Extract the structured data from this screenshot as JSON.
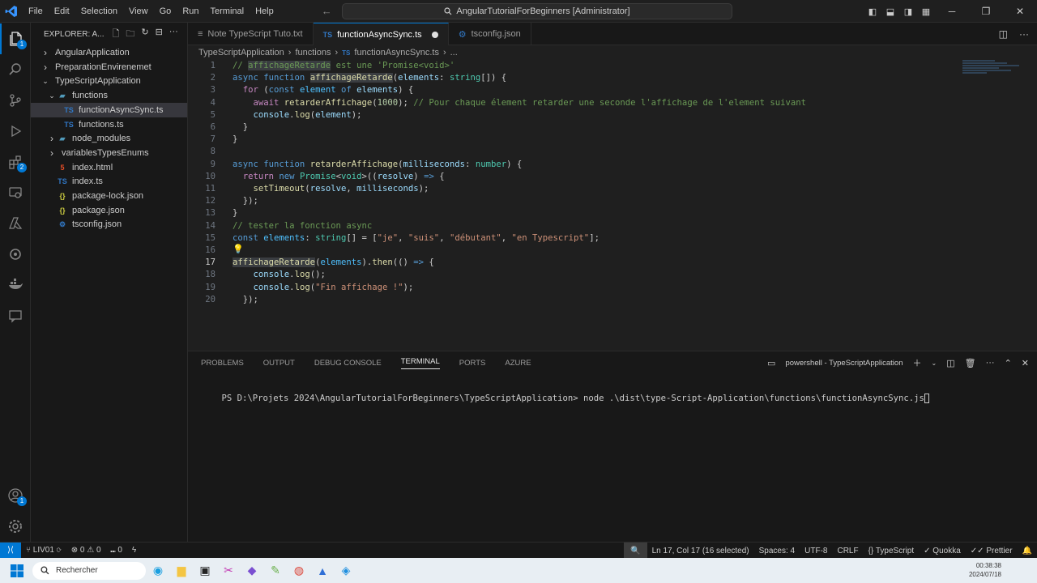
{
  "titlebar": {
    "menu": [
      "File",
      "Edit",
      "Selection",
      "View",
      "Go",
      "Run",
      "Terminal",
      "Help"
    ],
    "search": "AngularTutorialForBeginners [Administrator]"
  },
  "explorer": {
    "title": "EXPLORER: A...",
    "items": [
      {
        "label": "AngularApplication",
        "depth": 0,
        "chevron": "right",
        "icon": ""
      },
      {
        "label": "PreparationEnvirenemet",
        "depth": 0,
        "chevron": "right",
        "icon": ""
      },
      {
        "label": "TypeScriptApplication",
        "depth": 0,
        "chevron": "down",
        "icon": ""
      },
      {
        "label": "functions",
        "depth": 1,
        "chevron": "down",
        "icon": "folder"
      },
      {
        "label": "functionAsyncSync.ts",
        "depth": 2,
        "chevron": "",
        "icon": "ts",
        "selected": true
      },
      {
        "label": "functions.ts",
        "depth": 2,
        "chevron": "",
        "icon": "ts"
      },
      {
        "label": "node_modules",
        "depth": 1,
        "chevron": "right",
        "icon": "folder"
      },
      {
        "label": "variablesTypesEnums",
        "depth": 1,
        "chevron": "right",
        "icon": ""
      },
      {
        "label": "index.html",
        "depth": 1,
        "chevron": "",
        "icon": "html"
      },
      {
        "label": "index.ts",
        "depth": 1,
        "chevron": "",
        "icon": "ts"
      },
      {
        "label": "package-lock.json",
        "depth": 1,
        "chevron": "",
        "icon": "json"
      },
      {
        "label": "package.json",
        "depth": 1,
        "chevron": "",
        "icon": "json"
      },
      {
        "label": "tsconfig.json",
        "depth": 1,
        "chevron": "",
        "icon": "tsconfig"
      }
    ]
  },
  "tabs": [
    {
      "label": "Note TypeScript Tuto.txt",
      "active": false,
      "dirty": false
    },
    {
      "label": "functionAsyncSync.ts",
      "active": true,
      "dirty": true
    },
    {
      "label": "tsconfig.json",
      "active": false,
      "dirty": false
    }
  ],
  "breadcrumb": [
    "TypeScriptApplication",
    "functions",
    "functionAsyncSync.ts",
    "..."
  ],
  "editor": {
    "current_line": 17,
    "lines": [
      [
        [
          "com",
          "// "
        ],
        [
          "com hl",
          "affichageRetarde"
        ],
        [
          "com",
          " est une 'Promise<void>'"
        ]
      ],
      [
        [
          "kw",
          "async "
        ],
        [
          "kw",
          "function "
        ],
        [
          "fn hl",
          "affichageRetarde"
        ],
        [
          "",
          "("
        ],
        [
          "var",
          "elements"
        ],
        [
          "",
          ": "
        ],
        [
          "typ",
          "string"
        ],
        [
          "",
          "[]) {"
        ]
      ],
      [
        [
          "",
          "  "
        ],
        [
          "ctl",
          "for "
        ],
        [
          "",
          "("
        ],
        [
          "kw",
          "const "
        ],
        [
          "cst",
          "element "
        ],
        [
          "kw",
          "of "
        ],
        [
          "var",
          "elements"
        ],
        [
          "",
          ") {"
        ]
      ],
      [
        [
          "",
          "    "
        ],
        [
          "ctl",
          "await "
        ],
        [
          "fn",
          "retarderAffichage"
        ],
        [
          "",
          "("
        ],
        [
          "num",
          "1000"
        ],
        [
          "",
          "); "
        ],
        [
          "com",
          "// Pour chaque élement retarder une seconde l'affichage de l'element suivant"
        ]
      ],
      [
        [
          "",
          "    "
        ],
        [
          "var",
          "console"
        ],
        [
          "",
          "."
        ],
        [
          "fn",
          "log"
        ],
        [
          "",
          "("
        ],
        [
          "var",
          "element"
        ],
        [
          "",
          ");"
        ]
      ],
      [
        [
          "",
          "  }"
        ]
      ],
      [
        [
          "",
          "}"
        ]
      ],
      [
        [
          "",
          ""
        ]
      ],
      [
        [
          "kw",
          "async "
        ],
        [
          "kw",
          "function "
        ],
        [
          "fn",
          "retarderAffichage"
        ],
        [
          "",
          "("
        ],
        [
          "var",
          "milliseconds"
        ],
        [
          "",
          ": "
        ],
        [
          "typ",
          "number"
        ],
        [
          "",
          ") {"
        ]
      ],
      [
        [
          "",
          "  "
        ],
        [
          "ctl",
          "return "
        ],
        [
          "kw",
          "new "
        ],
        [
          "typ",
          "Promise"
        ],
        [
          "",
          "<"
        ],
        [
          "typ",
          "void"
        ],
        [
          "",
          ">(("
        ],
        [
          "var",
          "resolve"
        ],
        [
          "",
          ") "
        ],
        [
          "kw",
          "=> "
        ],
        [
          "",
          "{"
        ]
      ],
      [
        [
          "",
          "    "
        ],
        [
          "fn",
          "setTimeout"
        ],
        [
          "",
          "("
        ],
        [
          "var",
          "resolve"
        ],
        [
          "",
          ", "
        ],
        [
          "var",
          "milliseconds"
        ],
        [
          "",
          ");"
        ]
      ],
      [
        [
          "",
          "  });"
        ]
      ],
      [
        [
          "",
          "}"
        ]
      ],
      [
        [
          "com",
          "// tester la fonction async"
        ]
      ],
      [
        [
          "kw",
          "const "
        ],
        [
          "cst",
          "elements"
        ],
        [
          "",
          ": "
        ],
        [
          "typ",
          "string"
        ],
        [
          "",
          "[] = ["
        ],
        [
          "str",
          "\"je\""
        ],
        [
          "",
          ", "
        ],
        [
          "str",
          "\"suis\""
        ],
        [
          "",
          ", "
        ],
        [
          "str",
          "\"débutant\""
        ],
        [
          "",
          ", "
        ],
        [
          "str",
          "\"en Typescript\""
        ],
        [
          "",
          "];"
        ]
      ],
      [
        [
          "",
          ""
        ]
      ],
      [
        [
          "fn hl",
          "affichageRetarde"
        ],
        [
          "",
          "("
        ],
        [
          "cst",
          "elements"
        ],
        [
          "",
          ")."
        ],
        [
          "fn",
          "then"
        ],
        [
          "",
          "(() "
        ],
        [
          "kw",
          "=> "
        ],
        [
          "",
          "{"
        ]
      ],
      [
        [
          "",
          "    "
        ],
        [
          "var",
          "console"
        ],
        [
          "",
          "."
        ],
        [
          "fn",
          "log"
        ],
        [
          "",
          "();"
        ]
      ],
      [
        [
          "",
          "    "
        ],
        [
          "var",
          "console"
        ],
        [
          "",
          "."
        ],
        [
          "fn",
          "log"
        ],
        [
          "",
          "("
        ],
        [
          "str",
          "\"Fin affichage !\""
        ],
        [
          "",
          ");"
        ]
      ],
      [
        [
          "",
          "  });"
        ]
      ]
    ]
  },
  "panel": {
    "tabs": [
      "PROBLEMS",
      "OUTPUT",
      "DEBUG CONSOLE",
      "TERMINAL",
      "PORTS",
      "AZURE"
    ],
    "active_tab": "TERMINAL",
    "terminal_name": "powershell - TypeScriptApplication",
    "terminal_text": "PS D:\\Projets 2024\\AngularTutorialForBeginners\\TypeScriptApplication> node .\\dist\\type-Script-Application\\functions\\functionAsyncSync.js"
  },
  "statusbar": {
    "branch": "LIV01",
    "errors": "0",
    "warnings": "0",
    "ports": "0",
    "position": "Ln 17, Col 17 (16 selected)",
    "spaces": "Spaces: 4",
    "encoding": "UTF-8",
    "eol": "CRLF",
    "language": "TypeScript",
    "quokka": "Quokka",
    "prettier": "Prettier"
  },
  "taskbar": {
    "search_placeholder": "Rechercher",
    "time": "00:38:38",
    "date": "2024/07/18"
  },
  "colors": {
    "accent": "#0078d4",
    "editor_bg": "#1f1f1f",
    "sidebar_bg": "#181818"
  }
}
